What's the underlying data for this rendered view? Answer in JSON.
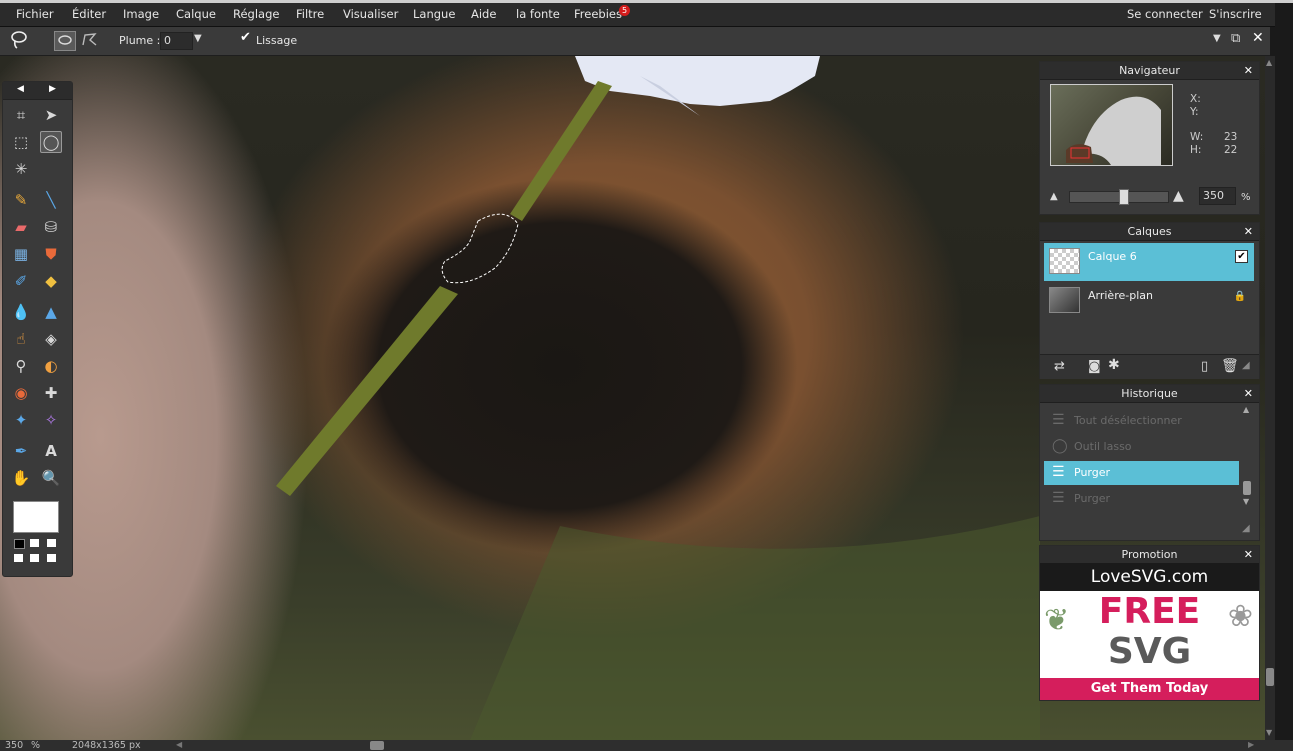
{
  "menubar": {
    "items": [
      "Fichier",
      "Éditer",
      "Image",
      "Calque",
      "Réglage",
      "Filtre",
      "Visualiser",
      "Langue",
      "Aide",
      "la fonte",
      "Freebies"
    ],
    "freebies_badge": "5",
    "login": "Se connecter",
    "signup": "S'inscrire"
  },
  "options": {
    "plume_label": "Plume :",
    "plume_value": "0",
    "smoothing_label": "Lissage",
    "smoothing_checked": "✔"
  },
  "navigator": {
    "title": "Navigateur",
    "x_label": "X:",
    "y_label": "Y:",
    "w_label": "W:",
    "w_value": "23",
    "h_label": "H:",
    "h_value": "22",
    "zoom_value": "350",
    "zoom_unit": "%",
    "slider_level": 0.55
  },
  "layers": {
    "title": "Calques",
    "items": [
      {
        "name": "Calque 6",
        "checked": "✔"
      },
      {
        "name": "Arrière-plan"
      }
    ]
  },
  "history": {
    "title": "Historique",
    "items": [
      "Tout désélectionner",
      "Outil lasso",
      "Purger",
      "Purger"
    ]
  },
  "promotion": {
    "title": "Promotion",
    "brand": "LoveSVG.com",
    "headline": "FREE",
    "subhead": "SVG",
    "cta": "Get Them Today"
  },
  "status": {
    "zoom": "350",
    "zoom_unit": "%",
    "dimensions": "2048x1365 px"
  },
  "colors": {
    "accent": "#5bbfd6",
    "badge": "#d41c1c",
    "promo_pink": "#d51e5c"
  }
}
